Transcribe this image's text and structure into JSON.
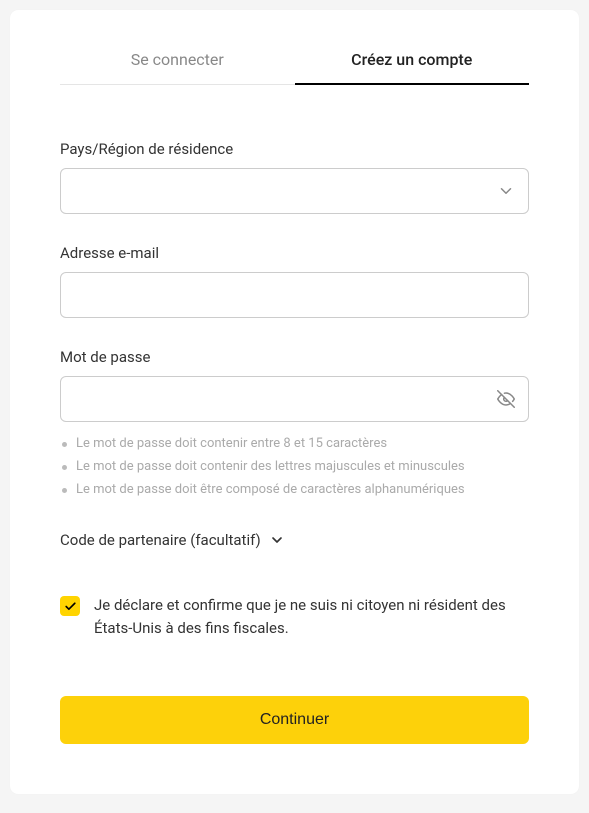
{
  "tabs": {
    "login": "Se connecter",
    "signup": "Créez un compte"
  },
  "form": {
    "country_label": "Pays/Région de résidence",
    "country_value": "",
    "email_label": "Adresse e-mail",
    "email_value": "",
    "password_label": "Mot de passe",
    "password_value": "",
    "rules": [
      "Le mot de passe doit contenir entre 8 et 15 caractères",
      "Le mot de passe doit contenir des lettres majuscules et minuscules",
      "Le mot de passe doit être composé de caractères alphanumériques"
    ]
  },
  "partner": {
    "label": "Code de partenaire (facultatif)"
  },
  "declaration": {
    "checked": true,
    "text": "Je déclare et confirme que je ne suis ni citoyen ni résident des États-Unis à des fins fiscales."
  },
  "submit_label": "Continuer",
  "colors": {
    "accent": "#fdd10a"
  }
}
